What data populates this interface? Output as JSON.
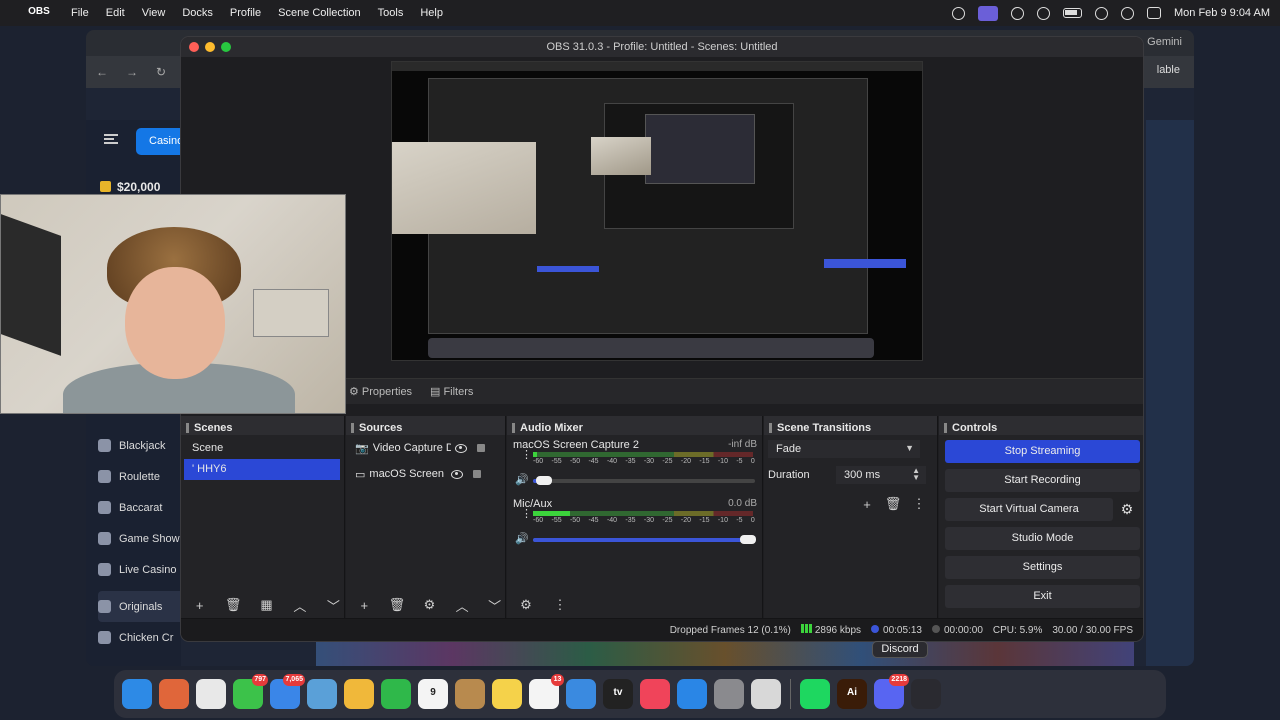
{
  "menubar": {
    "apple_icon": "apple-icon",
    "app_name": "OBS",
    "items": [
      "File",
      "Edit",
      "View",
      "Docks",
      "Profile",
      "Scene Collection",
      "Tools",
      "Help"
    ],
    "clock": "Mon Feb 9  9:04 AM"
  },
  "browser": {
    "gemini_label": "Gemini",
    "right_button": "lable",
    "casino_tab": "Casino",
    "balance": "$20,000",
    "nav_items": [
      "Blackjack",
      "Roulette",
      "Baccarat",
      "Game Show",
      "Live Casino",
      "Originals",
      "Chicken Cr"
    ]
  },
  "obs": {
    "title": "OBS 31.0.3 - Profile: Untitled - Scenes: Untitled",
    "properties_tab": "Properties",
    "filters_tab": "Filters",
    "scenes": {
      "header": "Scenes",
      "items": [
        "Scene",
        "' HHY6"
      ]
    },
    "sources": {
      "header": "Sources",
      "items": [
        "Video Capture Devi",
        "macOS Screen Capt"
      ]
    },
    "mixer": {
      "header": "Audio Mixer",
      "ticks": [
        "-60",
        "-55",
        "-50",
        "-45",
        "-40",
        "-35",
        "-30",
        "-25",
        "-20",
        "-15",
        "-10",
        "-5",
        "0"
      ],
      "channels": [
        {
          "name": "macOS Screen Capture 2",
          "db": "-inf dB",
          "level": 0.02,
          "volume": 0.05
        },
        {
          "name": "Mic/Aux",
          "db": "0.0 dB",
          "level": 0.17,
          "volume": 0.97
        }
      ]
    },
    "transitions": {
      "header": "Scene Transitions",
      "selected": "Fade",
      "duration_label": "Duration",
      "duration_value": "300 ms"
    },
    "controls": {
      "header": "Controls",
      "buttons": [
        "Stop Streaming",
        "Start Recording",
        "Start Virtual Camera",
        "Studio Mode",
        "Settings",
        "Exit"
      ]
    },
    "status": {
      "dropped": "Dropped Frames 12 (0.1%)",
      "bitrate": "2896 kbps",
      "stream_time": "00:05:13",
      "record_time": "00:00:00",
      "cpu": "CPU: 5.9%",
      "fps": "30.00 / 30.00 FPS"
    }
  },
  "tooltip": "Discord",
  "dock": {
    "apps": [
      {
        "name": "finder",
        "color": "#2d8ae6",
        "label": ""
      },
      {
        "name": "launchpad",
        "color": "#e0663a",
        "label": ""
      },
      {
        "name": "chrome",
        "color": "#e8e8e8",
        "label": ""
      },
      {
        "name": "messages",
        "color": "#3cc24a",
        "label": "",
        "badge": "797"
      },
      {
        "name": "mail",
        "color": "#3a86e8",
        "label": "",
        "badge": "7,065"
      },
      {
        "name": "maps",
        "color": "#5aa0d8",
        "label": ""
      },
      {
        "name": "photos",
        "color": "#f0b83a",
        "label": ""
      },
      {
        "name": "facetime",
        "color": "#2fb84a",
        "label": ""
      },
      {
        "name": "calendar",
        "color": "#f4f4f4",
        "label": "9"
      },
      {
        "name": "contacts",
        "color": "#b88a4e",
        "label": ""
      },
      {
        "name": "notes",
        "color": "#f5d24a",
        "label": ""
      },
      {
        "name": "reminders",
        "color": "#f4f4f4",
        "label": "",
        "badge": "13"
      },
      {
        "name": "freeform",
        "color": "#3a8ae0",
        "label": ""
      },
      {
        "name": "apple-tv",
        "color": "#222",
        "label": "tv"
      },
      {
        "name": "music",
        "color": "#f0445a",
        "label": ""
      },
      {
        "name": "app-store",
        "color": "#2a86e6",
        "label": ""
      },
      {
        "name": "system-settings",
        "color": "#8a8a8e",
        "label": ""
      },
      {
        "name": "gpt-app",
        "color": "#d8d8d8",
        "label": ""
      },
      {
        "name": "spotify",
        "color": "#1ed760",
        "label": ""
      },
      {
        "name": "illustrator",
        "color": "#3a1c08",
        "label": "Ai"
      },
      {
        "name": "discord",
        "color": "#5865f2",
        "label": "",
        "badge": "2218"
      },
      {
        "name": "obs",
        "color": "#2a2a30",
        "label": ""
      }
    ]
  },
  "colors": {
    "accent": "#2b48d6",
    "obs_bg": "#1e1e21",
    "meter_green": "#3cd43c"
  }
}
